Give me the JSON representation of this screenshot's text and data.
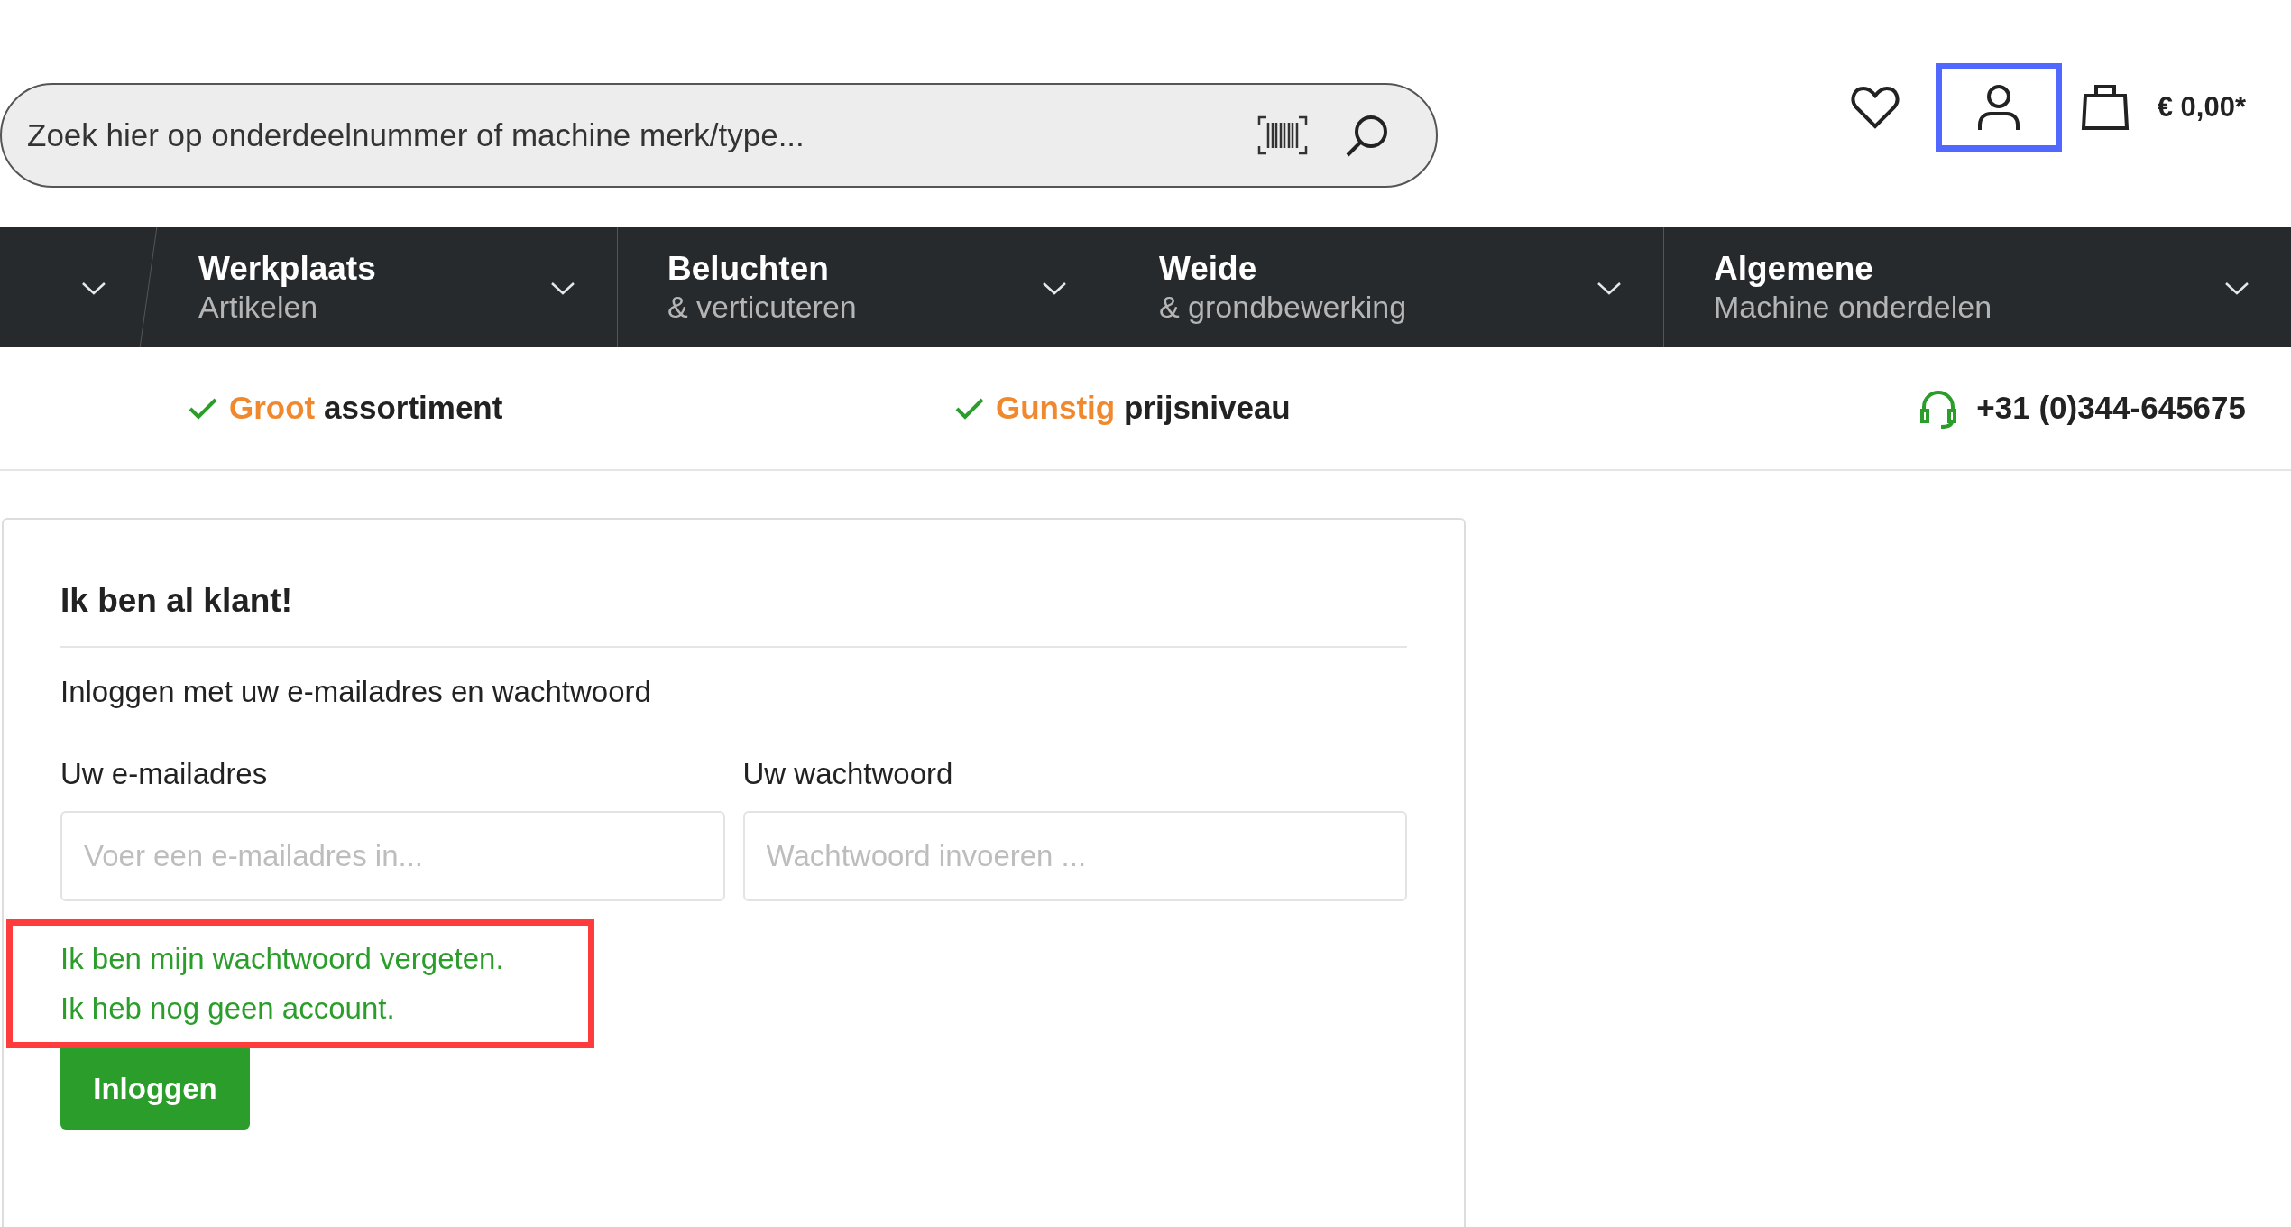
{
  "header": {
    "search": {
      "placeholder": "Zoek hier op onderdeelnummer of machine merk/type..."
    },
    "account": {
      "highlighted": true
    },
    "cart_total": "€ 0,00*"
  },
  "nav_items": [
    {
      "title": "Werkplaats",
      "subtitle": "Artikelen"
    },
    {
      "title": "Beluchten",
      "subtitle": "& verticuteren"
    },
    {
      "title": "Weide",
      "subtitle": "& grondbewerking"
    },
    {
      "title": "Algemene",
      "subtitle": "Machine onderdelen"
    }
  ],
  "usps": [
    {
      "highlight": "Groot",
      "text": "assortiment"
    },
    {
      "highlight": "Gunstig",
      "text": "prijsniveau"
    }
  ],
  "phone": "+31 (0)344-645675",
  "login": {
    "title": "Ik ben al klant!",
    "intro": "Inloggen met uw e-mailadres en wachtwoord",
    "fields": [
      {
        "label": "Uw e-mailadres",
        "placeholder": "Voer een e-mailadres in..."
      },
      {
        "label": "Uw wachtwoord",
        "placeholder": "Wachtwoord invoeren ..."
      }
    ],
    "links": [
      "Ik ben mijn wachtwoord vergeten.",
      "Ik heb nog geen account."
    ],
    "links_highlighted": true,
    "button": "Inloggen"
  }
}
